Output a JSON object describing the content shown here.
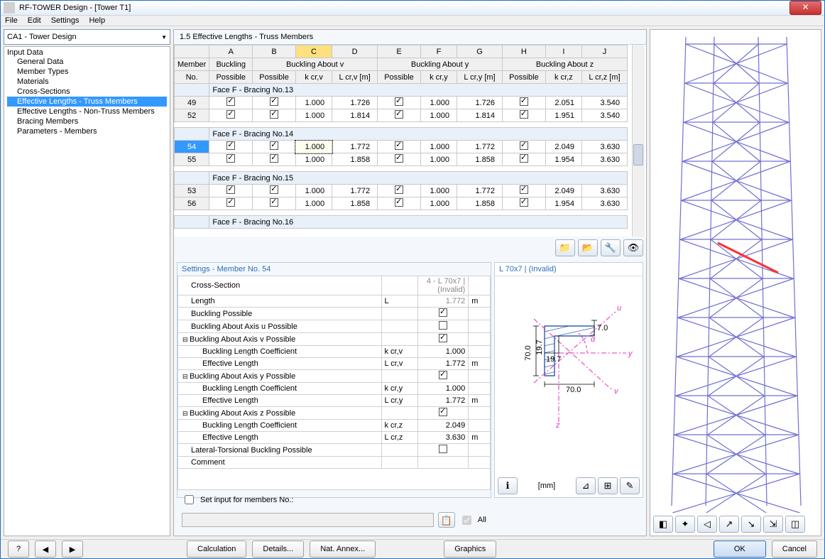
{
  "window": {
    "title": "RF-TOWER Design - [Tower T1]"
  },
  "menu": {
    "file": "File",
    "edit": "Edit",
    "settings": "Settings",
    "help": "Help"
  },
  "dropdown": {
    "label": "CA1 - Tower Design"
  },
  "tree": {
    "root": "Input Data",
    "items": [
      "General Data",
      "Member Types",
      "Materials",
      "Cross-Sections",
      "Effective Lengths - Truss Members",
      "Effective Lengths - Non-Truss Members",
      "Bracing Members",
      "Parameters - Members"
    ],
    "selected_index": 4
  },
  "panel": {
    "title": "1.5 Effective Lengths - Truss Members"
  },
  "grid": {
    "col_letters": [
      "A",
      "B",
      "C",
      "D",
      "E",
      "F",
      "G",
      "H",
      "I",
      "J"
    ],
    "selected_col": 2,
    "header_row1": {
      "member_no": "Member",
      "buckling": "Buckling",
      "about_v": "Buckling About v",
      "about_y": "Buckling About y",
      "about_z": "Buckling About z"
    },
    "header_row2": {
      "member_no": "No.",
      "possible": "Possible",
      "kcrv": "k cr,v",
      "lcrv": "L cr,v [m]",
      "kcry": "k cr,y",
      "lcry": "L cr,y [m]",
      "kcrz": "k cr,z",
      "lcrz": "L cr,z [m]"
    },
    "groups": [
      {
        "title": "Face F - Bracing No.13",
        "rows": [
          {
            "no": "49",
            "a": true,
            "b": true,
            "kcrv": "1.000",
            "lcrv": "1.726",
            "e": true,
            "kcry": "1.000",
            "lcry": "1.726",
            "h": true,
            "kcrz": "2.051",
            "lcrz": "3.540"
          },
          {
            "no": "52",
            "a": true,
            "b": true,
            "kcrv": "1.000",
            "lcrv": "1.814",
            "e": true,
            "kcry": "1.000",
            "lcry": "1.814",
            "h": true,
            "kcrz": "1.951",
            "lcrz": "3.540"
          }
        ]
      },
      {
        "title": "Face F - Bracing No.14",
        "rows": [
          {
            "no": "54",
            "sel": true,
            "a": true,
            "b": true,
            "kcrv": "1.000",
            "lcrv": "1.772",
            "e": true,
            "kcry": "1.000",
            "lcry": "1.772",
            "h": true,
            "kcrz": "2.049",
            "lcrz": "3.630"
          },
          {
            "no": "55",
            "a": true,
            "b": true,
            "kcrv": "1.000",
            "lcrv": "1.858",
            "e": true,
            "kcry": "1.000",
            "lcry": "1.858",
            "h": true,
            "kcrz": "1.954",
            "lcrz": "3.630"
          }
        ]
      },
      {
        "title": "Face F - Bracing No.15",
        "rows": [
          {
            "no": "53",
            "a": true,
            "b": true,
            "kcrv": "1.000",
            "lcrv": "1.772",
            "e": true,
            "kcry": "1.000",
            "lcry": "1.772",
            "h": true,
            "kcrz": "2.049",
            "lcrz": "3.630"
          },
          {
            "no": "56",
            "a": true,
            "b": true,
            "kcrv": "1.000",
            "lcrv": "1.858",
            "e": true,
            "kcry": "1.000",
            "lcry": "1.858",
            "h": true,
            "kcrz": "1.954",
            "lcrz": "3.630"
          }
        ]
      },
      {
        "title": "Face F - Bracing No.16",
        "rows": []
      }
    ]
  },
  "settings": {
    "title": "Settings - Member No. 54",
    "rows": [
      {
        "k": "Cross-Section",
        "s": "",
        "v": "4 - L 70x7 | (Invalid)",
        "u": "",
        "indent": 1,
        "gray": true
      },
      {
        "k": "Length",
        "s": "L",
        "v": "1.772",
        "u": "m",
        "indent": 1,
        "gray": true
      },
      {
        "k": "Buckling Possible",
        "s": "",
        "chk": true,
        "u": "",
        "indent": 1
      },
      {
        "k": "Buckling About Axis u Possible",
        "s": "",
        "chk": false,
        "u": "",
        "indent": 1
      },
      {
        "k": "Buckling About Axis v Possible",
        "s": "",
        "chk": true,
        "u": "",
        "group": true
      },
      {
        "k": "Buckling Length Coefficient",
        "s": "k cr,v",
        "v": "1.000",
        "u": "",
        "indent": 2,
        "sel": true
      },
      {
        "k": "Effective Length",
        "s": "L cr,v",
        "v": "1.772",
        "u": "m",
        "indent": 2
      },
      {
        "k": "Buckling About Axis y Possible",
        "s": "",
        "chk": true,
        "u": "",
        "group": true
      },
      {
        "k": "Buckling Length Coefficient",
        "s": "k cr,y",
        "v": "1.000",
        "u": "",
        "indent": 2
      },
      {
        "k": "Effective Length",
        "s": "L cr,y",
        "v": "1.772",
        "u": "m",
        "indent": 2
      },
      {
        "k": "Buckling About Axis z Possible",
        "s": "",
        "chk": true,
        "u": "",
        "group": true
      },
      {
        "k": "Buckling Length Coefficient",
        "s": "k cr,z",
        "v": "2.049",
        "u": "",
        "indent": 2
      },
      {
        "k": "Effective Length",
        "s": "L cr,z",
        "v": "3.630",
        "u": "m",
        "indent": 2
      },
      {
        "k": "Lateral-Torsional Buckling Possible",
        "s": "",
        "chk": false,
        "u": "",
        "indent": 1
      },
      {
        "k": "Comment",
        "s": "",
        "v": "",
        "u": "",
        "indent": 1
      }
    ],
    "set_input_label": "Set input for members No.:",
    "all_label": "All"
  },
  "diagram": {
    "title": "L 70x7 | (Invalid)",
    "unit": "[mm]",
    "dims": {
      "h": "70.0",
      "w": "70.0",
      "t1": "7.0",
      "c1": "19.7",
      "c2": "19.7"
    },
    "axes": {
      "u": "u",
      "v": "v",
      "y": "y",
      "z": "z",
      "a": "α"
    }
  },
  "footer": {
    "calculation": "Calculation",
    "details": "Details...",
    "nat_annex": "Nat. Annex...",
    "graphics": "Graphics",
    "ok": "OK",
    "cancel": "Cancel"
  }
}
